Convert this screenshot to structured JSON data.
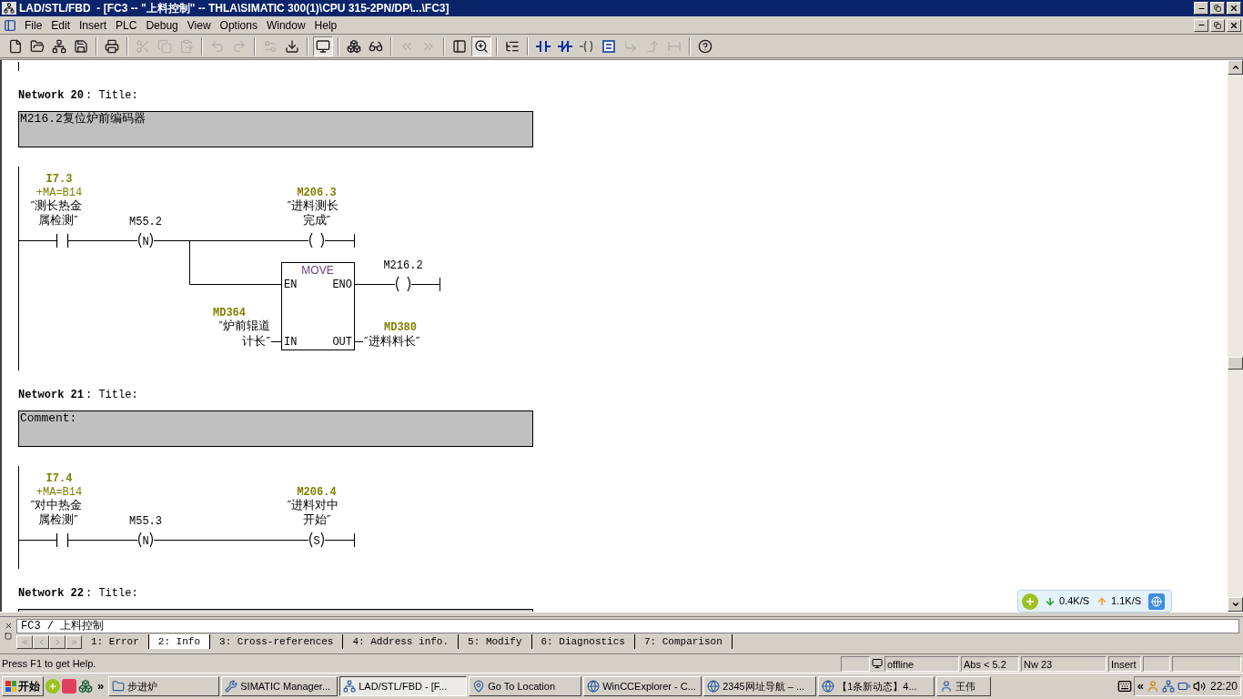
{
  "window": {
    "title": "LAD/STL/FBD  - [FC3 -- \"上料控制\" -- THLA\\SIMATIC 300(1)\\CPU 315-2PN/DP\\...\\FC3]"
  },
  "menu": [
    "File",
    "Edit",
    "Insert",
    "PLC",
    "Debug",
    "View",
    "Options",
    "Window",
    "Help"
  ],
  "toolbar": [
    {
      "kind": "button",
      "disabled": false,
      "pressed": false
    },
    {
      "kind": "button",
      "disabled": false,
      "pressed": false
    },
    {
      "kind": "button",
      "disabled": false,
      "pressed": false
    },
    {
      "kind": "button",
      "disabled": false,
      "pressed": false
    },
    {
      "kind": "separator"
    },
    {
      "kind": "button",
      "disabled": false,
      "pressed": false
    },
    {
      "kind": "separator"
    },
    {
      "kind": "button",
      "disabled": true,
      "pressed": false
    },
    {
      "kind": "button",
      "disabled": true,
      "pressed": false
    },
    {
      "kind": "button",
      "disabled": true,
      "pressed": false
    },
    {
      "kind": "separator"
    },
    {
      "kind": "button",
      "disabled": true,
      "pressed": false
    },
    {
      "kind": "button",
      "disabled": true,
      "pressed": false
    },
    {
      "kind": "separator"
    },
    {
      "kind": "button",
      "disabled": true,
      "pressed": false
    },
    {
      "kind": "button",
      "disabled": false,
      "pressed": false
    },
    {
      "kind": "separator"
    },
    {
      "kind": "button",
      "disabled": false,
      "pressed": true
    },
    {
      "kind": "separator"
    },
    {
      "kind": "button",
      "disabled": false,
      "pressed": false
    },
    {
      "kind": "button",
      "disabled": false,
      "pressed": false
    },
    {
      "kind": "separator"
    },
    {
      "kind": "button",
      "disabled": true,
      "pressed": false
    },
    {
      "kind": "button",
      "disabled": true,
      "pressed": false
    },
    {
      "kind": "separator"
    },
    {
      "kind": "button",
      "disabled": false,
      "pressed": false
    },
    {
      "kind": "button",
      "disabled": false,
      "pressed": true
    },
    {
      "kind": "separator"
    },
    {
      "kind": "button",
      "disabled": false,
      "pressed": false
    },
    {
      "kind": "separator"
    },
    {
      "kind": "button",
      "disabled": false,
      "pressed": false
    },
    {
      "kind": "button",
      "disabled": false,
      "pressed": false
    },
    {
      "kind": "button",
      "disabled": false,
      "pressed": false
    },
    {
      "kind": "button",
      "disabled": false,
      "pressed": false
    },
    {
      "kind": "button",
      "disabled": true,
      "pressed": false
    },
    {
      "kind": "button",
      "disabled": true,
      "pressed": false
    },
    {
      "kind": "button",
      "disabled": true,
      "pressed": false
    },
    {
      "kind": "separator"
    },
    {
      "kind": "button",
      "disabled": false,
      "pressed": false
    }
  ],
  "networks": [
    {
      "label": "Network 20",
      "title": ": Title:",
      "comment": "M216.2复位炉前编码器",
      "kind": "branch_move",
      "contact": {
        "address": "I7.3",
        "tag": "+MA=B14",
        "symbol": [
          "″测长热金",
          "属检测″"
        ]
      },
      "edge": {
        "address": "M55.2",
        "marker": "N"
      },
      "coil": {
        "kind": "assign",
        "address": "M206.3",
        "symbol": [
          "″进料测长",
          "完成″"
        ]
      },
      "move": {
        "name": "MOVE",
        "en": "EN",
        "eno": "ENO",
        "in_pin": "IN",
        "out_pin": "OUT",
        "in": {
          "address": "MD364",
          "symbol": [
            "″炉前辊道",
            "计长″"
          ]
        },
        "out": {
          "address": "MD380",
          "symbol": "″进料料长″"
        },
        "coil": {
          "kind": "assign",
          "address": "M216.2"
        }
      }
    },
    {
      "label": "Network 21",
      "title": ": Title:",
      "comment": "Comment:",
      "kind": "series",
      "contact": {
        "address": "I7.4",
        "tag": "+MA=B14",
        "symbol": [
          "″对中热金",
          "属检测″"
        ]
      },
      "edge": {
        "address": "M55.3",
        "marker": "N"
      },
      "coil": {
        "kind": "set",
        "marker": "S",
        "address": "M206.4",
        "symbol": [
          "″进料对中",
          "开始″"
        ]
      }
    },
    {
      "label": "Network 22",
      "title": ": Title:",
      "kind": "cut"
    }
  ],
  "speed_widget": {
    "down": "0.4K/S",
    "up": "1.1K/S"
  },
  "details": {
    "path": "FC3 / 上料控制",
    "tabs": [
      {
        "label": "1: Error",
        "selected": false
      },
      {
        "label": "2: Info",
        "selected": true
      },
      {
        "label": "3: Cross-references",
        "selected": false
      },
      {
        "label": "4: Address info.",
        "selected": false
      },
      {
        "label": "5: Modify",
        "selected": false
      },
      {
        "label": "6: Diagnostics",
        "selected": false
      },
      {
        "label": "7: Comparison",
        "selected": false
      }
    ]
  },
  "status_bar": {
    "help": "Press F1 to get Help.",
    "mode": "offline",
    "abs": "Abs < 5.2",
    "network": "Nw 23",
    "insert": "Insert"
  },
  "taskbar": {
    "start": "开始",
    "more": "»",
    "items": [
      {
        "label": "步进炉",
        "selected": false
      },
      {
        "label": "SIMATIC Manager...",
        "selected": false
      },
      {
        "label": "LAD/STL/FBD  - [F...",
        "selected": true
      },
      {
        "label": "Go To Location",
        "selected": false
      },
      {
        "label": "WinCCExplorer - C...",
        "selected": false
      },
      {
        "label": "2345网址导航 – ...",
        "selected": false
      },
      {
        "label": "【1条新动态】4...",
        "selected": false
      },
      {
        "label": "王伟",
        "selected": false
      }
    ],
    "tray_more": "«",
    "clock": "22:20"
  }
}
